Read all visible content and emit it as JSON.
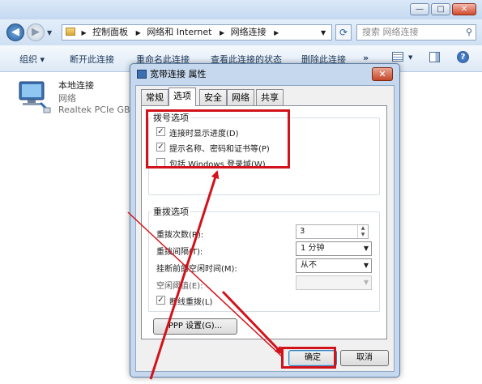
{
  "explorer": {
    "window_buttons": {
      "minimize": "—",
      "maximize": "□",
      "close": "✕"
    },
    "address": {
      "crumbs": [
        "控制面板",
        "网络和 Internet",
        "网络连接"
      ]
    },
    "search": {
      "placeholder": "搜索 网络连接"
    },
    "toolbar": {
      "organize": "组织 ▾",
      "disconnect": "断开此连接",
      "rename": "重命名此连接",
      "view_status": "查看此连接的状态",
      "delete": "删除此连接",
      "more": "»"
    },
    "connection": {
      "name": "本地连接",
      "status": "网络",
      "device": "Realtek PCIe GB"
    }
  },
  "dialog": {
    "title": "宽带连接 属性",
    "close_glyph": "✕",
    "tabs": [
      "常规",
      "选项",
      "安全",
      "网络",
      "共享"
    ],
    "dial_options": {
      "label": "拨号选项",
      "items": [
        {
          "label": "连接时显示进度(D)",
          "checked": true,
          "mark": "✓"
        },
        {
          "label": "提示名称、密码和证书等(P)",
          "checked": true,
          "mark": "✓"
        },
        {
          "label": "包括 Windows 登录域(W)",
          "checked": false,
          "mark": ""
        }
      ]
    },
    "redial_options": {
      "label": "重拨选项",
      "redial_attempts_label": "重拨次数(R):",
      "redial_attempts_value": "3",
      "redial_interval_label": "重拨间隔(T):",
      "redial_interval_value": "1 分钟",
      "idle_time_label": "挂断前的空闲时间(M):",
      "idle_time_value": "从不",
      "idle_threshold_label": "空闲阈值(E):",
      "idle_threshold_value": "",
      "redial_if_dropped_label": "断线重拨(L)",
      "redial_if_dropped_mark": "✓"
    },
    "ppp_settings": "PPP 设置(G)...",
    "ok": "确定",
    "cancel": "取消"
  },
  "colors": {
    "annotation": "#d2131b"
  }
}
